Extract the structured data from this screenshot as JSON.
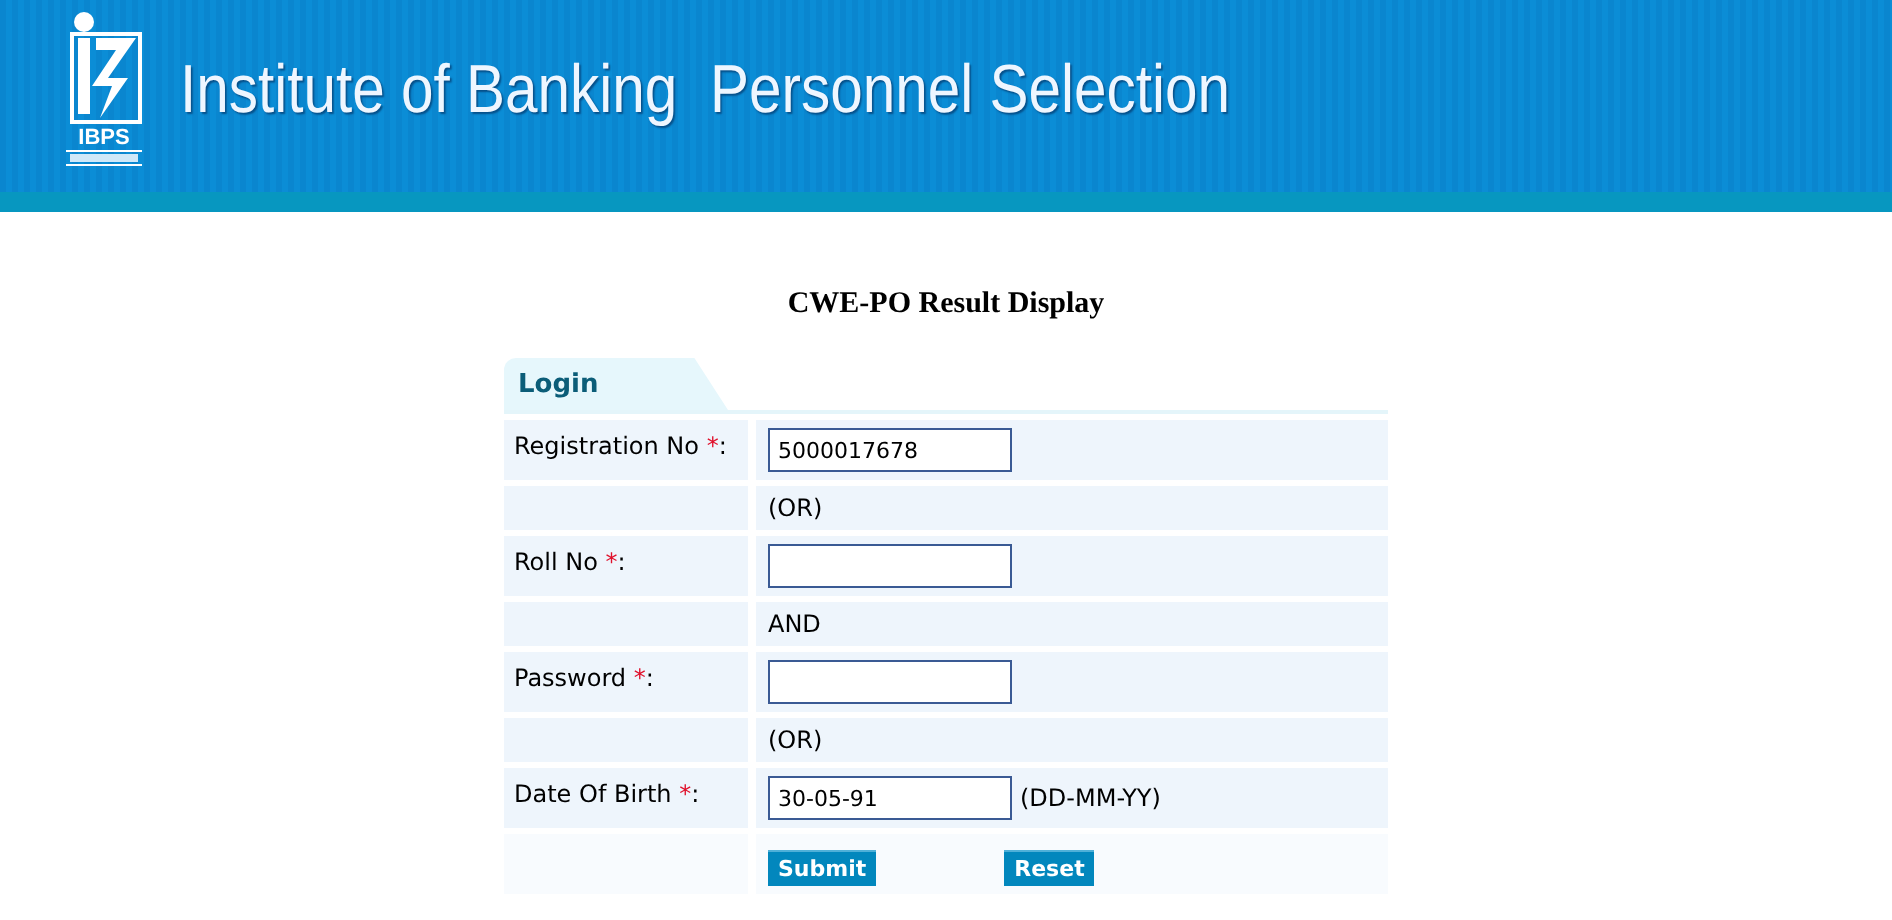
{
  "header": {
    "logo_text": "IBPS",
    "title": "Institute of Banking  Personnel Selection"
  },
  "page_title": "CWE-PO Result Display",
  "form": {
    "tab": "Login",
    "rows": [
      {
        "kind": "field",
        "label": "Registration No ",
        "mark": "*",
        "suffix": ":",
        "value": "5000017678"
      },
      {
        "kind": "note",
        "text": "(OR)"
      },
      {
        "kind": "field",
        "label": "Roll No ",
        "mark": "*",
        "suffix": ":",
        "value": ""
      },
      {
        "kind": "note",
        "text": "AND"
      },
      {
        "kind": "field",
        "label": "Password ",
        "mark": "*",
        "suffix": ":",
        "value": ""
      },
      {
        "kind": "note",
        "text": "(OR)"
      },
      {
        "kind": "field",
        "label": "Date Of Birth ",
        "mark": "*",
        "suffix": ":",
        "value": "30-05-91",
        "hint": "(DD-MM-YY)"
      }
    ],
    "buttons": [
      "Submit",
      "Reset"
    ]
  }
}
